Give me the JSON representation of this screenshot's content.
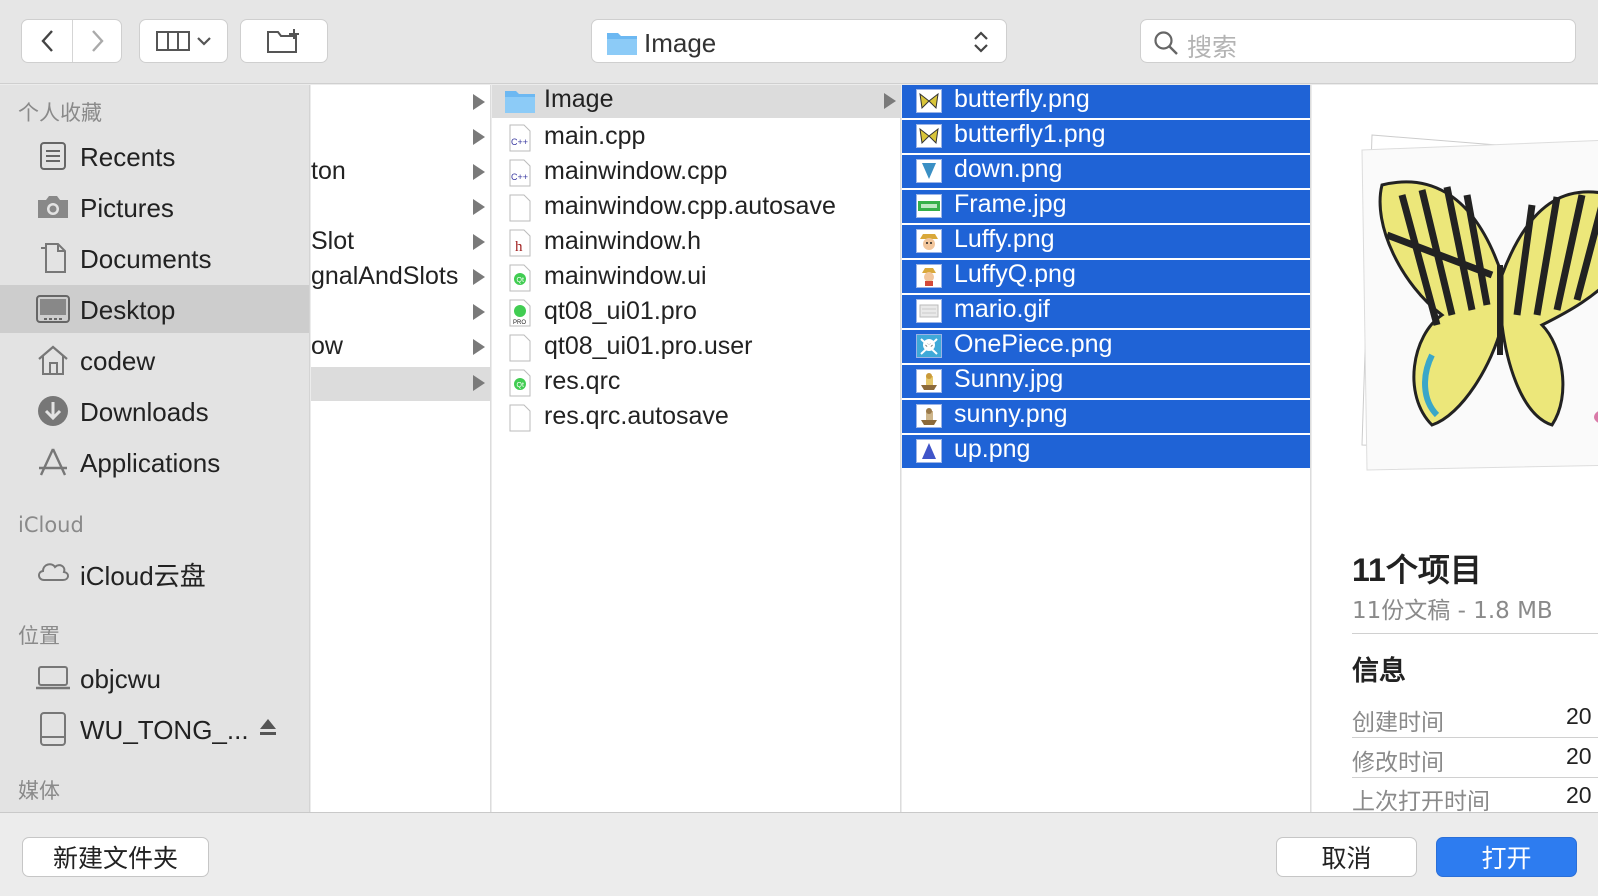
{
  "toolbar": {
    "location": "Image",
    "search_placeholder": "搜索"
  },
  "sidebar": {
    "favorites_title": "个人收藏",
    "favorites": [
      {
        "label": "Recents",
        "icon": "recents-icon"
      },
      {
        "label": "Pictures",
        "icon": "camera-icon"
      },
      {
        "label": "Documents",
        "icon": "document-icon"
      },
      {
        "label": "Desktop",
        "icon": "desktop-icon",
        "selected": true
      },
      {
        "label": "codew",
        "icon": "home-icon"
      },
      {
        "label": "Downloads",
        "icon": "download-icon"
      },
      {
        "label": "Applications",
        "icon": "applications-icon"
      }
    ],
    "icloud_title": "iCloud",
    "icloud_items": [
      {
        "label": "iCloud云盘",
        "icon": "cloud-icon"
      }
    ],
    "locations_title": "位置",
    "locations": [
      {
        "label": "objcwu",
        "icon": "laptop-icon"
      },
      {
        "label": "WU_TONG_...",
        "icon": "external-drive-icon",
        "eject": true
      }
    ],
    "media_title": "媒体"
  },
  "column1": [
    {
      "name": ""
    },
    {
      "name": ""
    },
    {
      "name": "ton"
    },
    {
      "name": ""
    },
    {
      "name": "Slot"
    },
    {
      "name": "gnalAndSlots"
    },
    {
      "name": ""
    },
    {
      "name": "ow"
    },
    {
      "name": "",
      "highlighted": true
    }
  ],
  "column2": [
    {
      "name": "Image",
      "icon": "folder-icon",
      "folder": true,
      "highlighted": true
    },
    {
      "name": "main.cpp",
      "icon": "cpp-file-icon"
    },
    {
      "name": "mainwindow.cpp",
      "icon": "cpp-file-icon"
    },
    {
      "name": "mainwindow.cpp.autosave",
      "icon": "blank-file-icon"
    },
    {
      "name": "mainwindow.h",
      "icon": "header-file-icon"
    },
    {
      "name": "mainwindow.ui",
      "icon": "qt-file-icon"
    },
    {
      "name": "qt08_ui01.pro",
      "icon": "qt-project-icon"
    },
    {
      "name": "qt08_ui01.pro.user",
      "icon": "blank-file-icon"
    },
    {
      "name": "res.qrc",
      "icon": "qt-file-icon"
    },
    {
      "name": "res.qrc.autosave",
      "icon": "blank-file-icon"
    }
  ],
  "column3": [
    {
      "name": "butterfly.png",
      "thumb": "butterfly-thumb",
      "color": "#d9c53a"
    },
    {
      "name": "butterfly1.png",
      "thumb": "butterfly-thumb",
      "color": "#d9c53a"
    },
    {
      "name": "down.png",
      "thumb": "arrow-down-thumb",
      "color": "#3a8fc4"
    },
    {
      "name": "Frame.jpg",
      "thumb": "frame-thumb",
      "color": "#36b04a"
    },
    {
      "name": "Luffy.png",
      "thumb": "luffy-thumb",
      "color": "#c8732c"
    },
    {
      "name": "LuffyQ.png",
      "thumb": "luffyq-thumb",
      "color": "#d44a3a"
    },
    {
      "name": "mario.gif",
      "thumb": "mario-thumb",
      "color": "#c9c9c9"
    },
    {
      "name": "OnePiece.png",
      "thumb": "skull-thumb",
      "color": "#3fa9d8"
    },
    {
      "name": "Sunny.jpg",
      "thumb": "ship-thumb",
      "color": "#c99a3a"
    },
    {
      "name": "sunny.png",
      "thumb": "ship-thumb",
      "color": "#8c6a3a"
    },
    {
      "name": "up.png",
      "thumb": "arrow-up-thumb",
      "color": "#4055c9"
    }
  ],
  "preview": {
    "count": "11个项目",
    "subtitle": "11份文稿 - 1.8 MB",
    "info_title": "信息",
    "info": [
      {
        "key": "创建时间",
        "value": "20"
      },
      {
        "key": "修改时间",
        "value": "20"
      },
      {
        "key": "上次打开时间",
        "value": "20"
      }
    ]
  },
  "footer": {
    "new_folder": "新建文件夹",
    "cancel": "取消",
    "open": "打开"
  },
  "colors": {
    "selection": "#1f63d6",
    "primary_button": "#2d7cf0"
  }
}
